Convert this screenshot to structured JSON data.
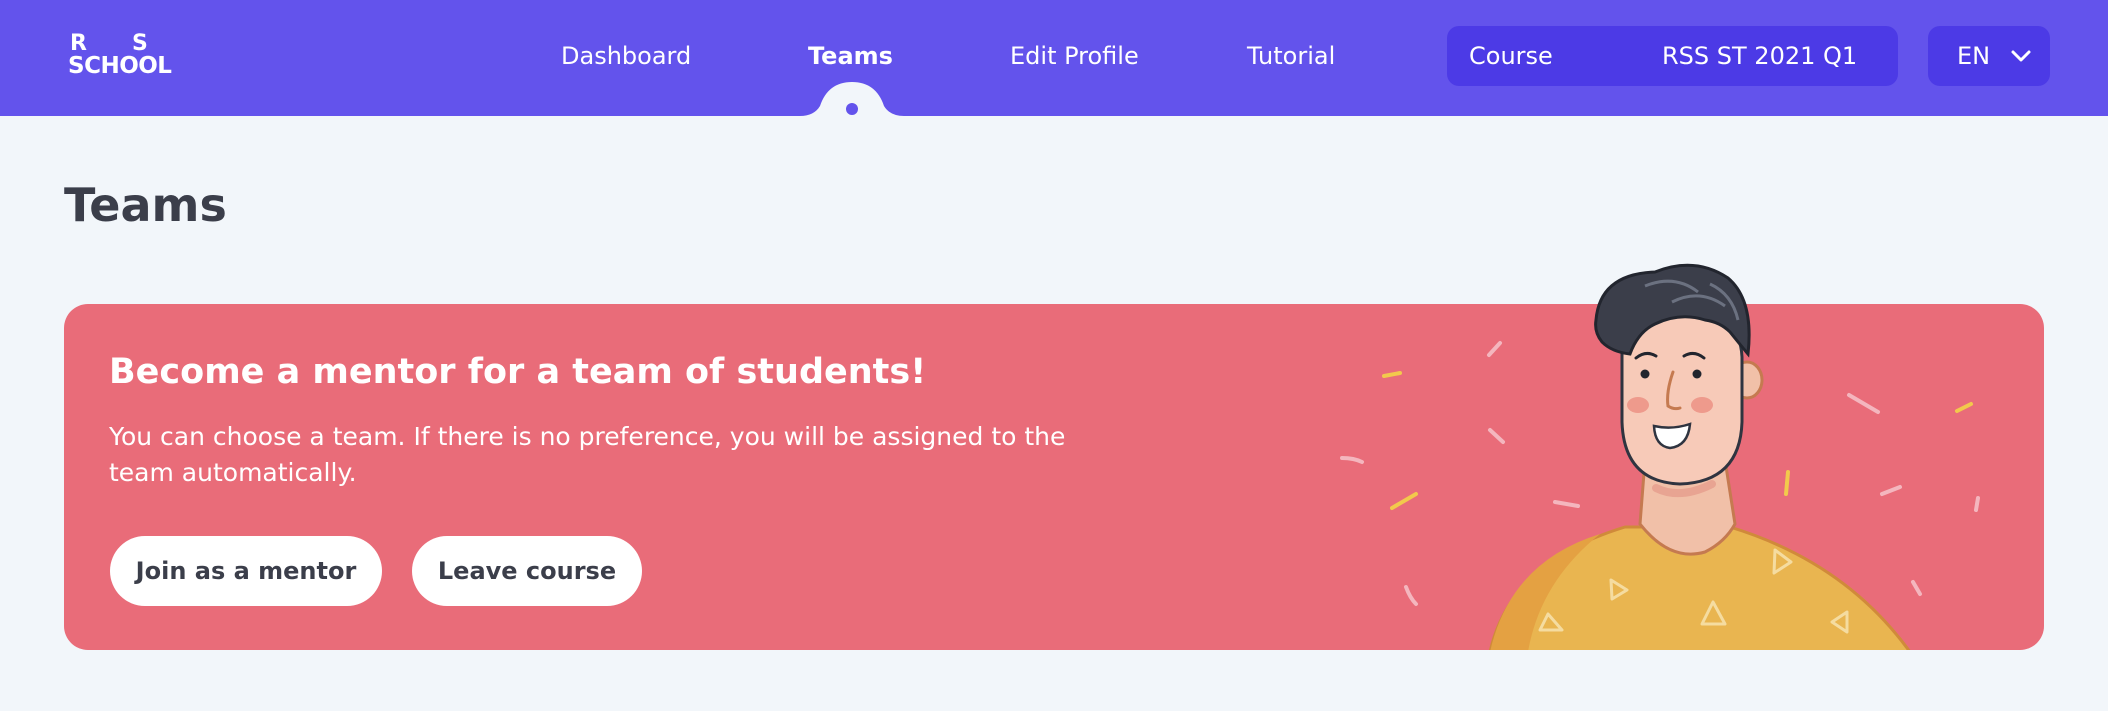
{
  "header": {
    "logo": {
      "line1a": "R",
      "line1b": "S",
      "line2": "SCHOOL"
    },
    "nav": [
      {
        "label": "Dashboard",
        "active": false
      },
      {
        "label": "Teams",
        "active": true
      },
      {
        "label": "Edit Profile",
        "active": false
      },
      {
        "label": "Tutorial",
        "active": false
      }
    ],
    "course_select": {
      "label": "Course",
      "value": "RSS ST 2021 Q1"
    },
    "language_select": {
      "value": "EN"
    }
  },
  "page": {
    "title": "Teams"
  },
  "banner": {
    "title": "Become a mentor for a team of students!",
    "description": "You can choose a team. If there is no preference, you will be assigned to the team automatically.",
    "join_button": "Join as a mentor",
    "leave_button": "Leave course"
  },
  "colors": {
    "header_bg": "#6353ec",
    "select_bg": "#4c3ae6",
    "page_bg": "#f2f6fa",
    "banner_bg": "#e96c79",
    "text_dark": "#3b3e4a"
  }
}
